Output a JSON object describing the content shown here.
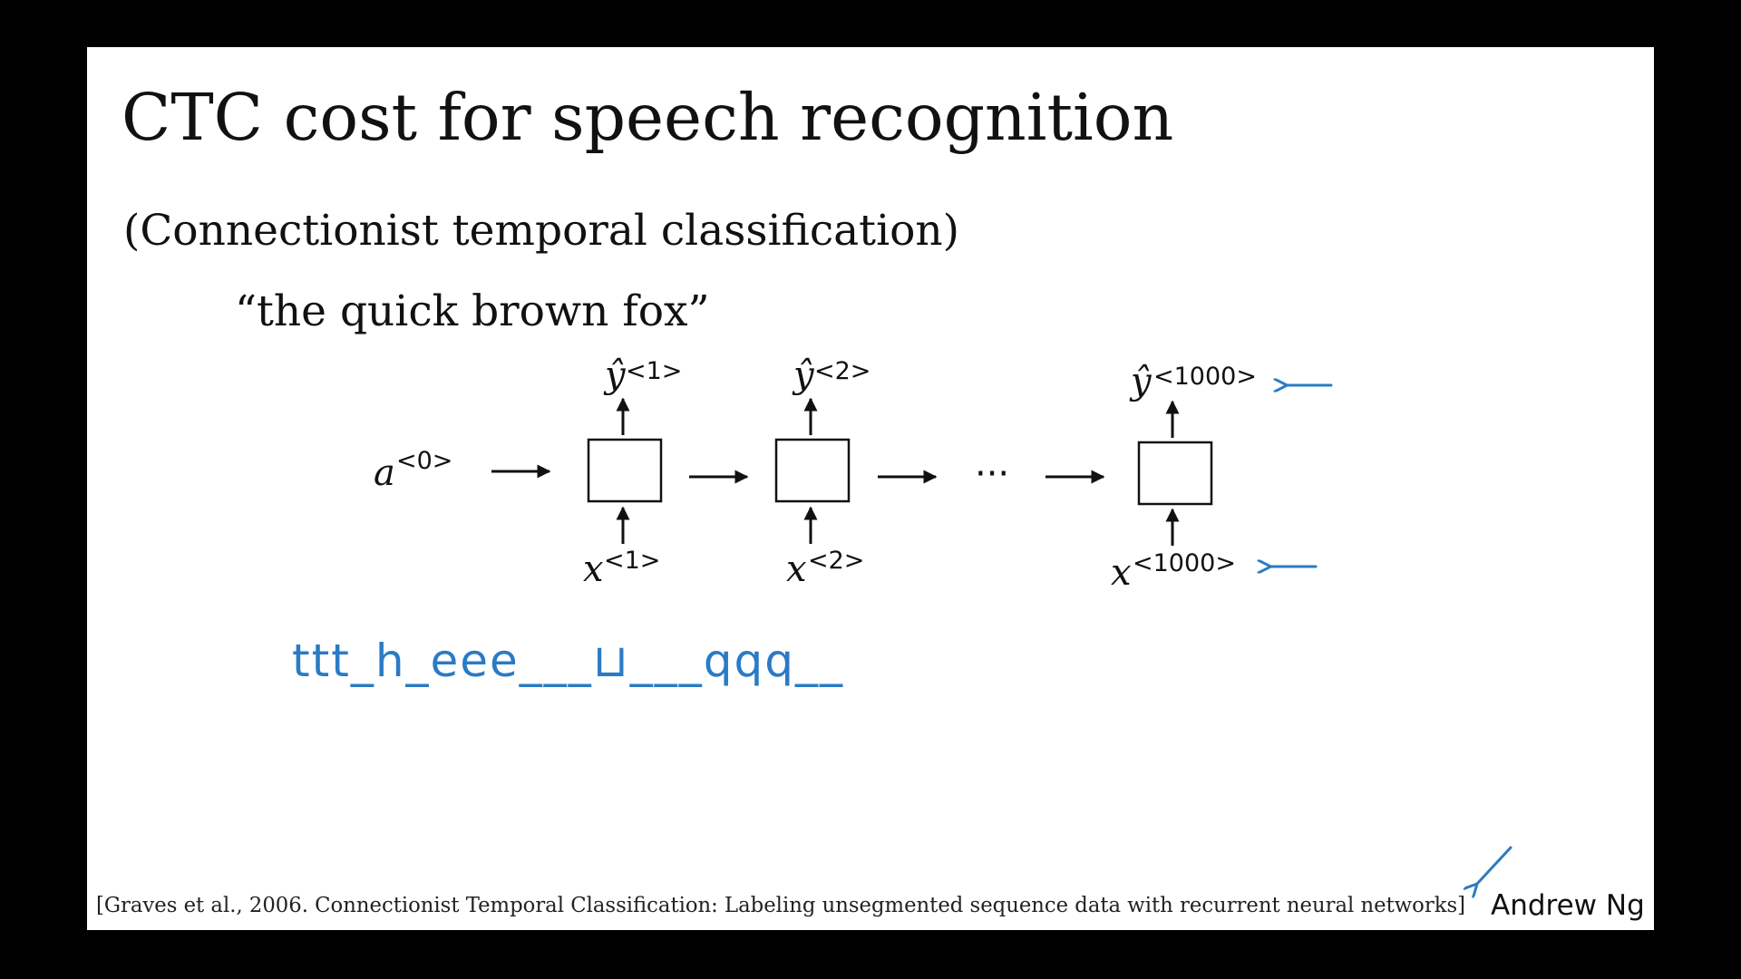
{
  "slide": {
    "title": "CTC cost for speech recognition",
    "subtitle": "(Connectionist temporal classification)",
    "example_sentence": "“the quick brown fox”",
    "citation": "[Graves et al., 2006. Connectionist Temporal Classification: Labeling unsegmented sequence data with recurrent neural networks]",
    "author": "Andrew Ng"
  },
  "diagram": {
    "initial_activation": {
      "var": "a",
      "sup": "<0>"
    },
    "outputs": [
      {
        "var": "ŷ",
        "sup": "<1>"
      },
      {
        "var": "ŷ",
        "sup": "<2>"
      },
      {
        "var": "ŷ",
        "sup": "<1000>"
      }
    ],
    "inputs": [
      {
        "var": "x",
        "sup": "<1>"
      },
      {
        "var": "x",
        "sup": "<2>"
      },
      {
        "var": "x",
        "sup": "<1000>"
      }
    ],
    "ellipsis": "···"
  },
  "annotations": {
    "handwritten_output": "ttt_h_eee___⊔___qqq__",
    "pen_color": "#2a7bc4"
  }
}
